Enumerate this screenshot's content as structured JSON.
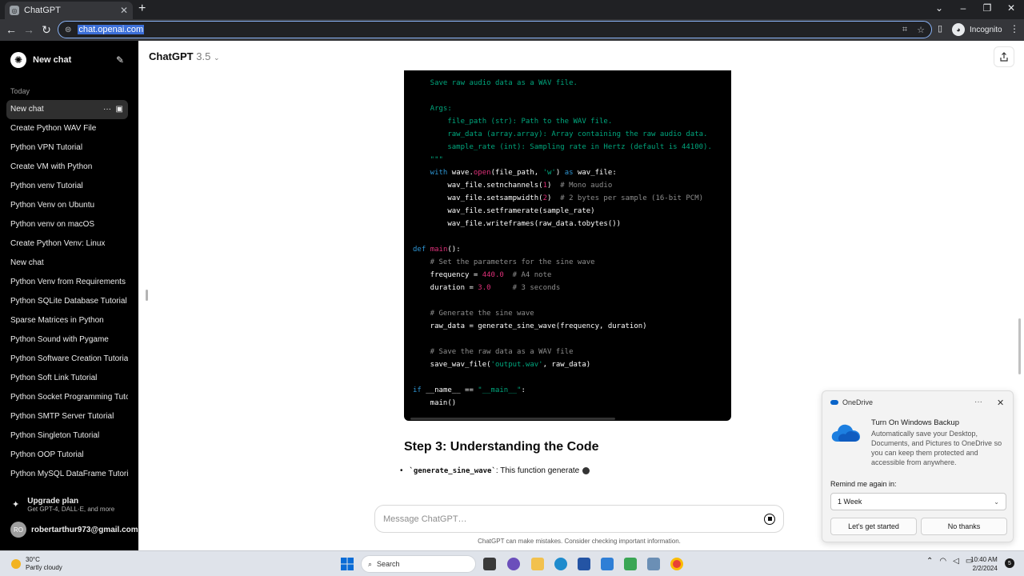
{
  "browser": {
    "tab_title": "ChatGPT",
    "new_tab": "+",
    "url": "chat.openai.com",
    "profile": "Incognito"
  },
  "sidebar": {
    "new_chat": "New chat",
    "section_today": "Today",
    "items": [
      "New chat",
      "Create Python WAV File",
      "Python VPN Tutorial",
      "Create VM with Python",
      "Python venv Tutorial",
      "Python Venv on Ubuntu",
      "Python venv on macOS",
      "Create Python Venv: Linux",
      "New chat",
      "Python Venv from Requirements",
      "Python SQLite Database Tutorial",
      "Sparse Matrices in Python",
      "Python Sound with Pygame",
      "Python Software Creation Tutorial",
      "Python Soft Link Tutorial",
      "Python Socket Programming Tuto",
      "Python SMTP Server Tutorial",
      "Python Singleton Tutorial",
      "Python OOP Tutorial",
      "Python MySQL DataFrame Tutorial"
    ],
    "upgrade_title": "Upgrade plan",
    "upgrade_sub": "Get GPT-4, DALL·E, and more",
    "user_initials": "RO",
    "user_email": "robertarthur973@gmail.com"
  },
  "header": {
    "model": "ChatGPT",
    "version": "3.5"
  },
  "code_lines": [
    [
      [
        "st",
        "    Save raw audio data as a WAV file."
      ]
    ],
    [
      [
        "st",
        ""
      ]
    ],
    [
      [
        "st",
        "    Args:"
      ]
    ],
    [
      [
        "st",
        "        file_path (str): Path to the WAV file."
      ]
    ],
    [
      [
        "st",
        "        raw_data (array.array): Array containing the raw audio data."
      ]
    ],
    [
      [
        "st",
        "        sample_rate (int): Sampling rate in Hertz (default is 44100)."
      ]
    ],
    [
      [
        "st",
        "    \"\"\""
      ]
    ],
    [
      [
        "kw",
        "    with "
      ],
      [
        "",
        "wave."
      ],
      [
        "fn",
        "open"
      ],
      [
        "",
        "(file_path, "
      ],
      [
        "st",
        "'w'"
      ],
      [
        "",
        ") "
      ],
      [
        "kw",
        "as"
      ],
      [
        "",
        " wav_file:"
      ]
    ],
    [
      [
        "",
        "        wav_file.setnchannels("
      ],
      [
        "nm",
        "1"
      ],
      [
        "",
        ")  "
      ],
      [
        "cm",
        "# Mono audio"
      ]
    ],
    [
      [
        "",
        "        wav_file.setsampwidth("
      ],
      [
        "nm",
        "2"
      ],
      [
        "",
        ")  "
      ],
      [
        "cm",
        "# 2 bytes per sample (16-bit PCM)"
      ]
    ],
    [
      [
        "",
        "        wav_file.setframerate(sample_rate)"
      ]
    ],
    [
      [
        "",
        "        wav_file.writeframes(raw_data.tobytes())"
      ]
    ],
    [
      [
        "",
        ""
      ]
    ],
    [
      [
        "kw",
        "def "
      ],
      [
        "fn",
        "main"
      ],
      [
        "",
        "():"
      ]
    ],
    [
      [
        "cm",
        "    # Set the parameters for the sine wave"
      ]
    ],
    [
      [
        "",
        "    frequency = "
      ],
      [
        "nm",
        "440.0"
      ],
      [
        "",
        "  "
      ],
      [
        "cm",
        "# A4 note"
      ]
    ],
    [
      [
        "",
        "    duration = "
      ],
      [
        "nm",
        "3.0"
      ],
      [
        "",
        "     "
      ],
      [
        "cm",
        "# 3 seconds"
      ]
    ],
    [
      [
        "",
        ""
      ]
    ],
    [
      [
        "cm",
        "    # Generate the sine wave"
      ]
    ],
    [
      [
        "",
        "    raw_data = generate_sine_wave(frequency, duration)"
      ]
    ],
    [
      [
        "",
        ""
      ]
    ],
    [
      [
        "cm",
        "    # Save the raw data as a WAV file"
      ]
    ],
    [
      [
        "",
        "    save_wav_file("
      ],
      [
        "st",
        "'output.wav'"
      ],
      [
        "",
        ", raw_data)"
      ]
    ],
    [
      [
        "",
        ""
      ]
    ],
    [
      [
        "kw",
        "if "
      ],
      [
        "",
        "__name__ == "
      ],
      [
        "st",
        "\"__main__\""
      ],
      [
        "",
        ":"
      ]
    ],
    [
      [
        "",
        "    main()"
      ]
    ]
  ],
  "content": {
    "step_heading": "Step 3: Understanding the Code",
    "bullet_code": "`generate_sine_wave`",
    "bullet_text": ": This function generate"
  },
  "composer": {
    "placeholder": "Message ChatGPT…",
    "disclaimer": "ChatGPT can make mistakes. Consider checking important information."
  },
  "onedrive": {
    "app": "OneDrive",
    "title": "Turn On Windows Backup",
    "body": "Automatically save your Desktop, Documents, and Pictures to OneDrive so you can keep them protected and accessible from anywhere.",
    "remind_label": "Remind me again in:",
    "remind_value": "1 Week",
    "primary": "Let's get started",
    "secondary": "No thanks"
  },
  "taskbar": {
    "temp": "30°C",
    "weather": "Partly cloudy",
    "search": "Search",
    "time": "10:40 AM",
    "date": "2/2/2024",
    "notifications": "5"
  },
  "colors": {
    "accent": "#8ab4f8",
    "keyword": "#2e95d3",
    "function": "#df3079",
    "string": "#00a67d",
    "comment": "#8e8e8e"
  }
}
